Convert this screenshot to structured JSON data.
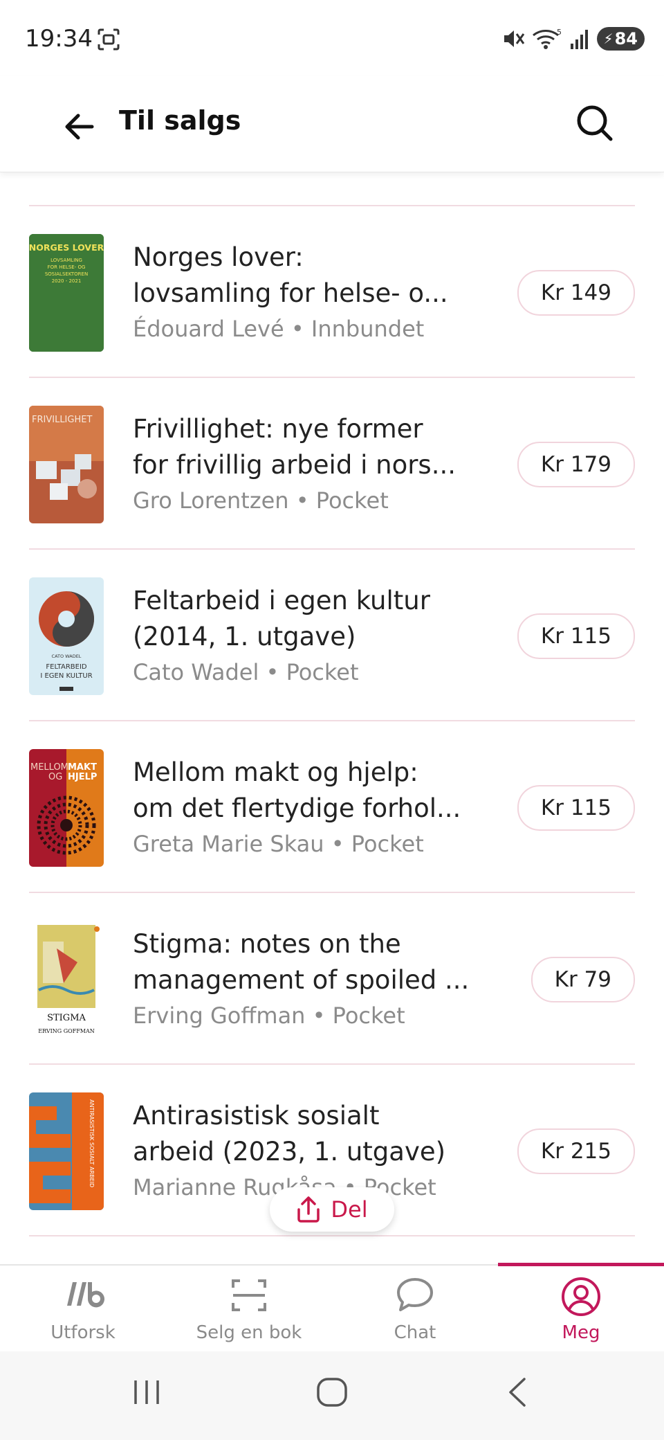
{
  "status_bar": {
    "time": "19:34",
    "battery": "84",
    "wifi_badge": "5"
  },
  "header": {
    "title": "Til salgs"
  },
  "books": [
    {
      "title_line1": "Norges lover:",
      "title_line2": "lovsamling for helse- o...",
      "author": "Édouard Levé",
      "format": "Innbundet",
      "price": "Kr 149",
      "cover_lines": [
        "NORGES LOVER",
        "LOVSAMLING",
        "FOR HELSE- OG",
        "SOSIALSEKTOREN",
        "2020 - 2021"
      ]
    },
    {
      "title_line1": "Frivillighet: nye former",
      "title_line2": "for frivillig arbeid i nors...",
      "author": "Gro Lorentzen",
      "format": "Pocket",
      "price": "Kr 179",
      "cover_lines": [
        "FRIVILLIGHET"
      ]
    },
    {
      "title_line1": "Feltarbeid i egen kultur",
      "title_line2": "(2014, 1. utgave)",
      "author": "Cato Wadel",
      "format": "Pocket",
      "price": "Kr 115",
      "cover_lines": [
        "CATO WADEL",
        "FELTARBEID",
        "I EGEN KULTUR"
      ]
    },
    {
      "title_line1": "Mellom makt og hjelp:",
      "title_line2": "om det flertydige forhol...",
      "author": "Greta Marie Skau",
      "format": "Pocket",
      "price": "Kr 115",
      "cover_lines": [
        "MELLOM",
        "OG",
        "MAKT",
        "HJELP"
      ]
    },
    {
      "title_line1": "Stigma: notes on the",
      "title_line2": "management of spoiled ...",
      "author": "Erving Goffman",
      "format": "Pocket",
      "price": "Kr 79",
      "cover_lines": [
        "STIGMA",
        "ERVING GOFFMAN"
      ]
    },
    {
      "title_line1": "Antirasistisk sosialt",
      "title_line2": "arbeid (2023, 1. utgave)",
      "author": "Marianne Rugkåsa",
      "format": "Pocket",
      "price": "Kr 215",
      "cover_lines": [
        "ANTIRASISTISK SOSIALT ARBEID"
      ]
    }
  ],
  "separator": "•",
  "share": {
    "label": "Del"
  },
  "bottom_nav": {
    "items": [
      {
        "label": "Utforsk"
      },
      {
        "label": "Selg en bok"
      },
      {
        "label": "Chat"
      },
      {
        "label": "Meg"
      }
    ],
    "active_index": 3
  },
  "colors": {
    "accent": "#c2185b",
    "divider": "#f1dbe1",
    "muted_text": "#8b8b8b"
  }
}
